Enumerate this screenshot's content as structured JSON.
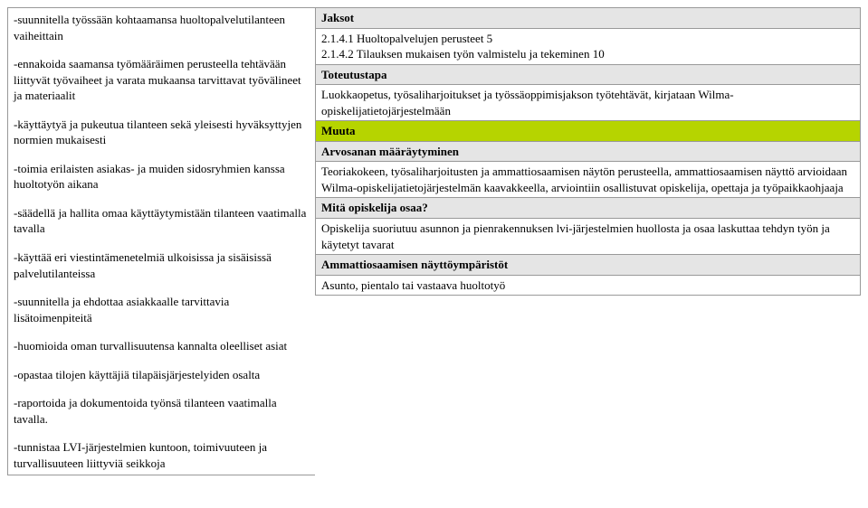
{
  "left": {
    "p1": "-suunnitella työssään kohtaamansa huoltopalvelutilanteen vaiheittain",
    "p2": "-ennakoida saamansa työmääräimen perusteella tehtävään liittyvät työvaiheet ja varata mukaansa tarvittavat työvälineet ja materiaalit",
    "p3": "-käyttäytyä ja pukeutua tilanteen sekä yleisesti hyväksyttyjen normien mukaisesti",
    "p4": "-toimia erilaisten asiakas- ja muiden sidosryhmien kanssa huoltotyön aikana",
    "p5": "-säädellä ja hallita omaa käyttäytymistään tilanteen vaatimalla tavalla",
    "p6": "-käyttää eri viestintämenetelmiä ulkoisissa ja sisäisissä palvelutilanteissa",
    "p7": "-suunnitella ja ehdottaa asiakkaalle tarvittavia lisätoimenpiteitä",
    "p8": "-huomioida oman turvallisuutensa kannalta oleelliset asiat",
    "p9": "-opastaa tilojen käyttäjiä tilapäisjärjestelyiden osalta",
    "p10": "-raportoida ja dokumentoida työnsä tilanteen vaatimalla tavalla.",
    "p11": "-tunnistaa LVI-järjestelmien kuntoon, toimivuuteen ja turvallisuuteen liittyviä seikkoja"
  },
  "right": {
    "jaksot_h": "Jaksot",
    "jaksot_l1": "2.1.4.1 Huoltopalvelujen perusteet 5",
    "jaksot_l2": "2.1.4.2 Tilauksen mukaisen työn valmistelu ja tekeminen 10",
    "toteutus_h": "Toteutustapa",
    "toteutus_c": "Luokkaopetus, työsaliharjoitukset ja työssäoppimisjakson työtehtävät, kirjataan Wilma-opiskelijatietojärjestelmään",
    "muuta_h": "Muuta",
    "arvosana_h": "Arvosanan määräytyminen",
    "arvosana_c": "Teoriakokeen, työsaliharjoitusten ja ammattiosaamisen näytön perusteella, ammattiosaamisen näyttö arvioidaan Wilma-opiskelijatietojärjestelmän kaavakkeella, arviointiin osallistuvat opiskelija, opettaja ja työpaikkaohjaaja",
    "osaa_h": "Mitä opiskelija osaa?",
    "osaa_c": "Opiskelija suoriutuu asunnon ja pienrakennuksen lvi-järjestelmien huollosta ja osaa laskuttaa tehdyn työn ja käytetyt tavarat",
    "ymp_h": "Ammattiosaamisen näyttöympäristöt",
    "ymp_c": "Asunto, pientalo tai vastaava huoltotyö"
  }
}
